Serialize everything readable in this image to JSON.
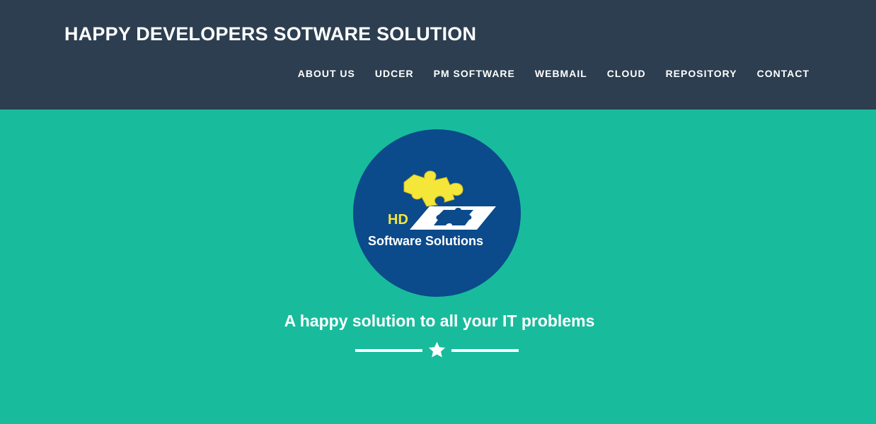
{
  "header": {
    "brand": "HAPPY DEVELOPERS SOTWARE SOLUTION",
    "nav_items": [
      {
        "label": "ABOUT US"
      },
      {
        "label": "UDCER"
      },
      {
        "label": "PM SOFTWARE"
      },
      {
        "label": "WEBMAIL"
      },
      {
        "label": "CLOUD"
      },
      {
        "label": "REPOSITORY"
      },
      {
        "label": "CONTACT"
      }
    ]
  },
  "hero": {
    "logo": {
      "initials": "HD",
      "company": "Software Solutions"
    },
    "tagline": "A happy solution to all your IT problems",
    "divider_icon": "star-icon"
  },
  "colors": {
    "navbar_bg": "#2c3e50",
    "hero_bg": "#18bc9c",
    "logo_bg": "#0b4a8b",
    "puzzle_yellow": "#f5e63a",
    "text": "#ffffff"
  }
}
